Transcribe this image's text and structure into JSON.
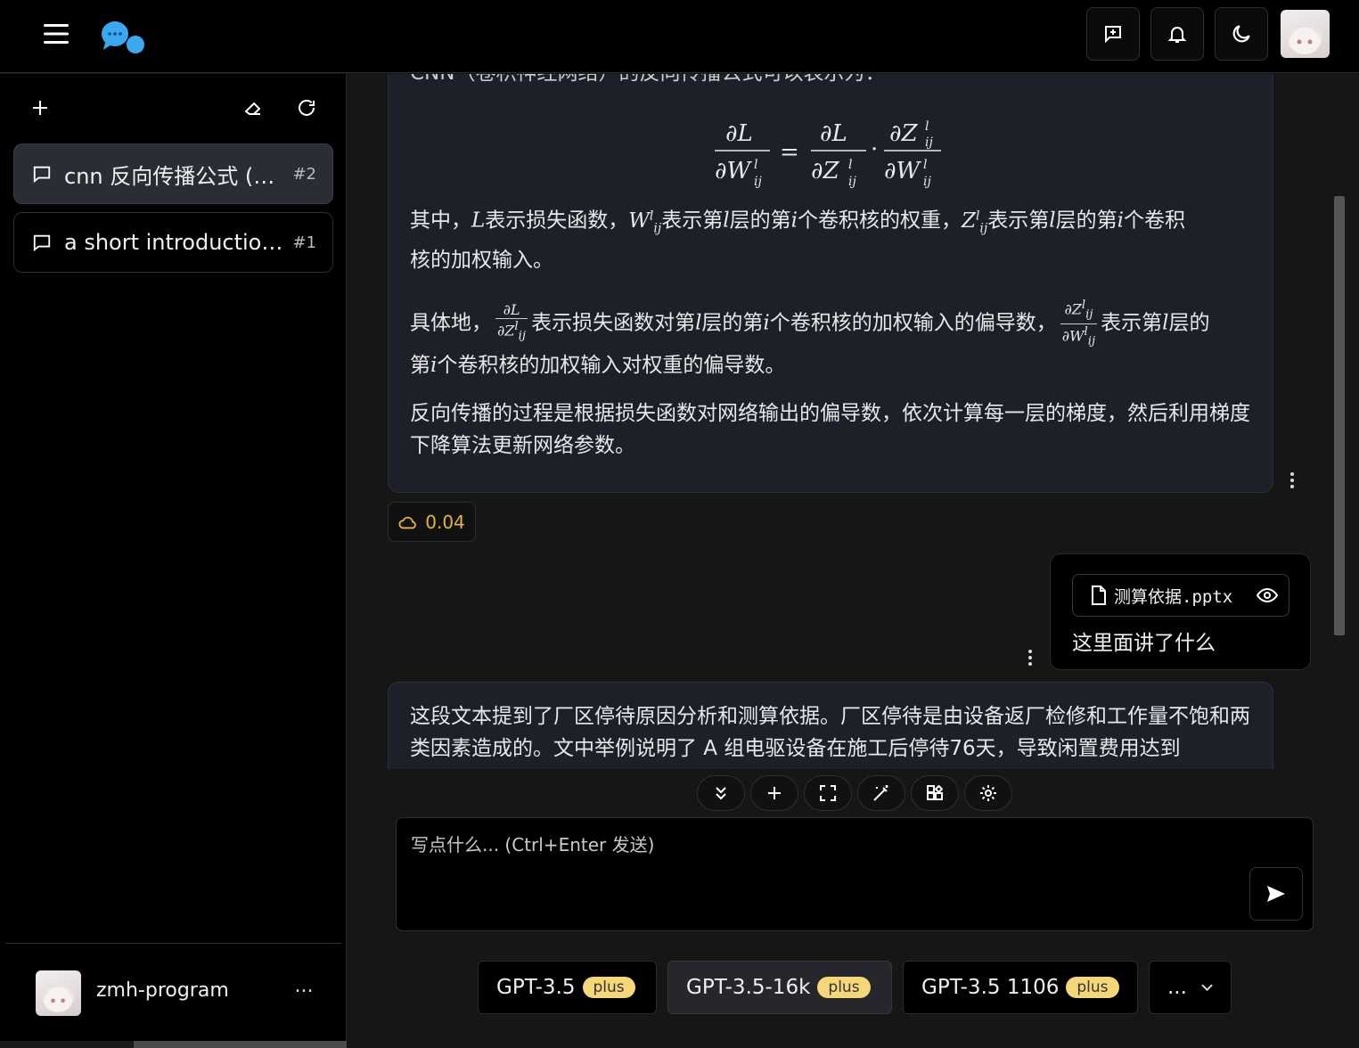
{
  "sidebar": {
    "conversations": [
      {
        "title": "cnn 反向传播公式 (公...",
        "num": "#2"
      },
      {
        "title": "a short introduction ...",
        "num": "#1"
      }
    ],
    "user_name": "zmh-program",
    "more_label": "..."
  },
  "messages": {
    "assistant_partial_intro": "CNN（卷积神经网络）的反向传播公式可以表示为：",
    "para1_a": "其中，",
    "para1_b": "表示损失函数，",
    "para1_c": "表示第",
    "para1_d": "层的第",
    "para1_e": "个卷积核的权重，",
    "para1_f": "表示第",
    "para1_g": "层的第",
    "para1_h": "个卷积",
    "para1_i": "核的加权输入。",
    "para2_a": "具体地，",
    "para2_b": "表示损失函数对第",
    "para2_c": "层的第",
    "para2_d": "个卷积核的加权输入的偏导数，",
    "para2_e": "表示第",
    "para2_f": "层的",
    "para2_g": "第",
    "para2_h": "个卷积核的加权输入对权重的偏导数。",
    "para3": "反向传播的过程是根据损失函数对网络输出的偏导数，依次计算每一层的梯度，然后利用梯度下降算法更新网络参数。",
    "cost": "0.04",
    "user_file": "测算依据.pptx",
    "user_text": "这里面讲了什么",
    "assistant2": "这段文本提到了厂区停待原因分析和测算依据。厂区停待是由设备返厂检修和工作量不饱和两类因素造成的。文中举例说明了 A 组电驱设备在施工后停待76天，导致闲置费用达到"
  },
  "input": {
    "placeholder": "写点什么... (Ctrl+Enter 发送)"
  },
  "models": [
    {
      "name": "GPT-3.5",
      "tag": "plus"
    },
    {
      "name": "GPT-3.5-16k",
      "tag": "plus"
    },
    {
      "name": "GPT-3.5 1106",
      "tag": "plus"
    }
  ],
  "models_more_label": "...",
  "colors": {
    "accent_yellow": "#f5d77a",
    "cost_color": "#e6b43c",
    "logo_blue": "#3aa8f0"
  }
}
